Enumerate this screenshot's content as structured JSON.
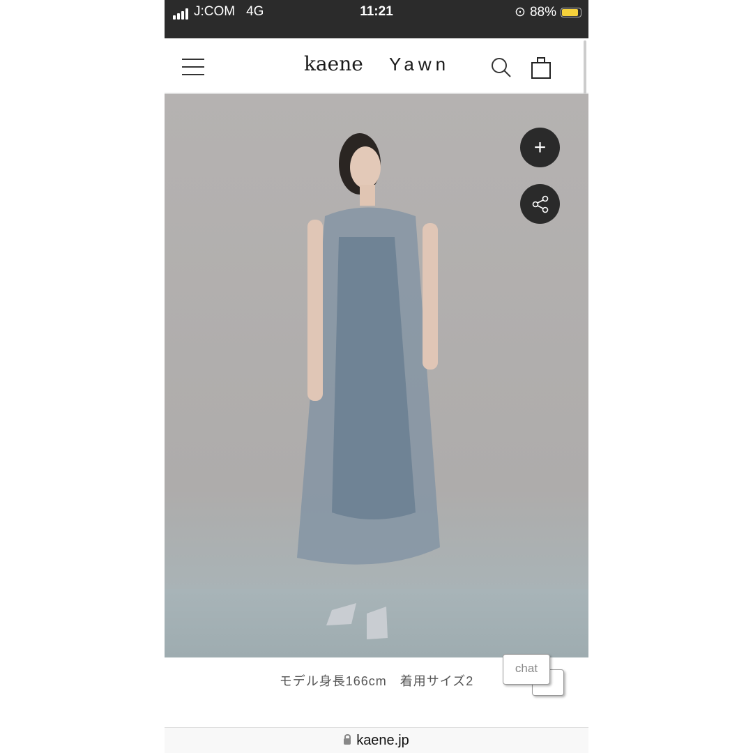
{
  "status_bar": {
    "carrier": "J:COM",
    "network": "4G",
    "time": "11:21",
    "battery": "88%",
    "battery_level": 0.88,
    "battery_color": "#f5d13b"
  },
  "header": {
    "logo_primary": "kaene",
    "logo_secondary": "Yawn"
  },
  "product_image": {
    "description_icon": "model-photo"
  },
  "caption": {
    "model_info": "モデル身長166cm　着用サイズ2"
  },
  "chat": {
    "label": "chat"
  },
  "browser": {
    "url": "kaene.jp"
  }
}
